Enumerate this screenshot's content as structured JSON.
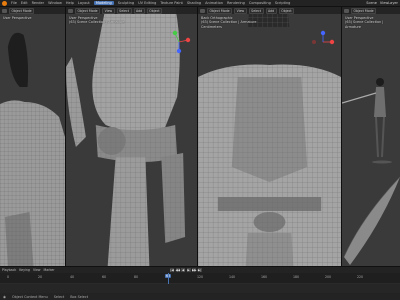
{
  "app": {
    "menus": [
      "File",
      "Edit",
      "Render",
      "Window",
      "Help"
    ],
    "workspaces": [
      "Layout",
      "Modeling",
      "Sculpting",
      "UV Editing",
      "Texture Paint",
      "Shading",
      "Animation",
      "Rendering",
      "Compositing",
      "Scripting"
    ],
    "active_workspace": "Modeling",
    "scene": "Scene",
    "view_layer": "ViewLayer"
  },
  "viewports": [
    {
      "mode": "Object Mode",
      "menus": [
        "View",
        "Select",
        "Add",
        "Object"
      ],
      "orientation": "Default",
      "view_name": "User Perspective",
      "collection": "(63) Scene Collection | Armature",
      "extra": ""
    },
    {
      "mode": "Object Mode",
      "menus": [
        "View",
        "Select",
        "Add",
        "Object"
      ],
      "orientation": "Default",
      "view_name": "User Perspective",
      "collection": "(63) Scene Collection | Armature",
      "extra": ""
    },
    {
      "mode": "Object Mode",
      "menus": [
        "View",
        "Select",
        "Add",
        "Object"
      ],
      "orientation": "Default",
      "view_name": "Back Orthographic",
      "collection": "(63) Scene Collection | Armature",
      "extra": "Centimeters"
    },
    {
      "mode": "Object Mode",
      "menus": [
        "View",
        "Select",
        "Add",
        "Object"
      ],
      "orientation": "Default",
      "view_name": "User Perspective",
      "collection": "(63) Scene Collection | Armature",
      "extra": ""
    }
  ],
  "timeline": {
    "menus": [
      "Playback",
      "Keying",
      "View",
      "Marker"
    ],
    "ticks": [
      "0",
      "20",
      "40",
      "60",
      "80",
      "100",
      "120",
      "140",
      "160",
      "180",
      "200",
      "220"
    ],
    "current_frame": "63",
    "play_controls": [
      "|◀",
      "◀◀",
      "◀",
      "▶",
      "▶▶",
      "▶|"
    ]
  },
  "status": {
    "left": "Object Context Menu",
    "mid": "Select",
    "right": "Box Select"
  },
  "colors": {
    "accent": "#4772b3",
    "logo": "#e87d0d",
    "viewport_bg": "#3b3b3b"
  }
}
